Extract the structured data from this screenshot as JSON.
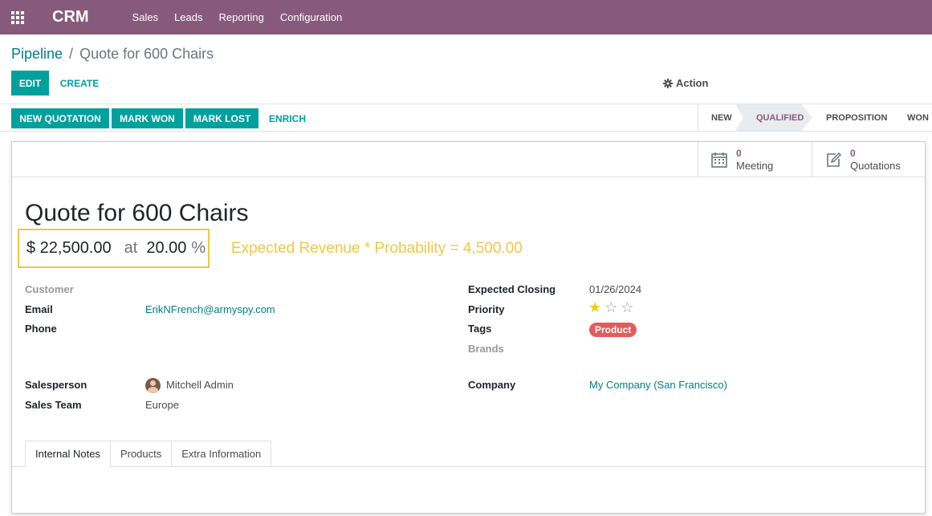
{
  "navbar": {
    "brand": "CRM",
    "menu": [
      "Sales",
      "Leads",
      "Reporting",
      "Configuration"
    ]
  },
  "breadcrumb": {
    "parent": "Pipeline",
    "separator": "/",
    "current": "Quote for 600 Chairs"
  },
  "control": {
    "edit": "EDIT",
    "create": "CREATE",
    "action": "Action"
  },
  "statusbar": {
    "buttons": [
      "NEW QUOTATION",
      "MARK WON",
      "MARK LOST",
      "ENRICH"
    ],
    "stages": [
      "NEW",
      "QUALIFIED",
      "PROPOSITION",
      "WON"
    ],
    "active_stage": "QUALIFIED"
  },
  "smart_buttons": {
    "meeting": {
      "value": "0",
      "label": "Meeting"
    },
    "quotations": {
      "value": "0",
      "label": "Quotations"
    }
  },
  "form": {
    "title": "Quote for 600 Chairs",
    "revenue": "$ 22,500.00",
    "at": "at",
    "probability": "20.00",
    "percent": "%",
    "expected_note": "Expected Revenue * Probability = 4,500.00",
    "customer_label": "Customer",
    "email_label": "Email",
    "email_value": "ErikNFrench@armyspy.com",
    "phone_label": "Phone",
    "salesperson_label": "Salesperson",
    "salesperson_value": "Mitchell Admin",
    "sales_team_label": "Sales Team",
    "sales_team_value": "Europe",
    "expected_closing_label": "Expected Closing",
    "expected_closing_value": "01/26/2024",
    "priority_label": "Priority",
    "priority_stars": 1,
    "priority_max": 3,
    "tags_label": "Tags",
    "tag_value": "Product",
    "brands_label": "Brands",
    "company_label": "Company",
    "company_value": "My Company (San Francisco)"
  },
  "tabs": [
    "Internal Notes",
    "Products",
    "Extra Information"
  ],
  "colors": {
    "brand": "#875a7b",
    "primary": "#00a09d",
    "link": "#017e84",
    "highlight": "#f0c842",
    "tag": "#e55b5b"
  }
}
